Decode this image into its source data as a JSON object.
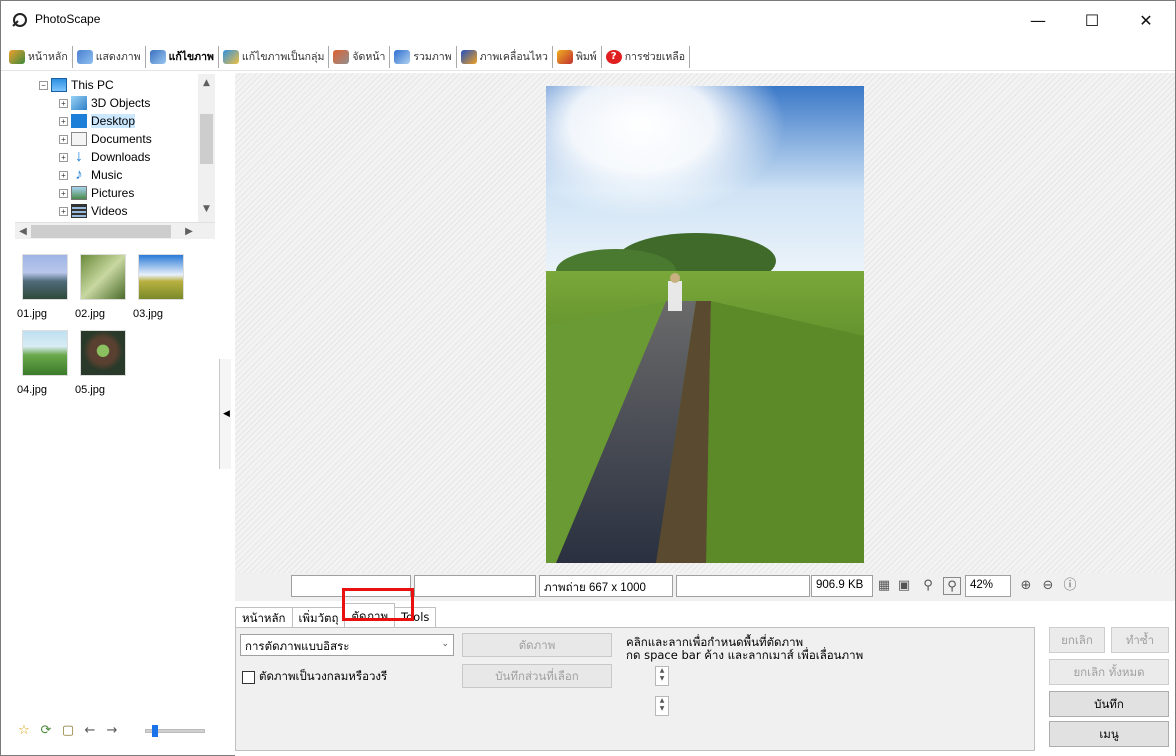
{
  "window": {
    "title": "PhotoScape"
  },
  "colors": {
    "highlight": "#e8110f",
    "selection": "#cce8ff"
  },
  "main_tabs": [
    {
      "label": "หน้าหลัก",
      "icon": "home-app-icon"
    },
    {
      "label": "แสดงภาพ",
      "icon": "viewer-icon"
    },
    {
      "label": "แก้ไขภาพ",
      "icon": "editor-icon",
      "active": true
    },
    {
      "label": "แก้ไขภาพเป็นกลุ่ม",
      "icon": "batch-icon"
    },
    {
      "label": "จัดหน้า",
      "icon": "page-icon"
    },
    {
      "label": "รวมภาพ",
      "icon": "combine-icon"
    },
    {
      "label": "ภาพเคลื่อนไหว",
      "icon": "animated-gif-icon"
    },
    {
      "label": "พิมพ์",
      "icon": "print-icon"
    },
    {
      "label": "การช่วยเหลือ",
      "icon": "help-icon"
    }
  ],
  "tree": [
    {
      "label": "This PC",
      "icon": "computer-icon"
    },
    {
      "label": "3D Objects",
      "icon": "3d-objects-icon"
    },
    {
      "label": "Desktop",
      "icon": "desktop-icon",
      "selected": true
    },
    {
      "label": "Documents",
      "icon": "documents-icon"
    },
    {
      "label": "Downloads",
      "icon": "downloads-icon"
    },
    {
      "label": "Music",
      "icon": "music-icon"
    },
    {
      "label": "Pictures",
      "icon": "pictures-icon"
    },
    {
      "label": "Videos",
      "icon": "videos-icon"
    }
  ],
  "thumbnails": [
    "01.jpg",
    "02.jpg",
    "03.jpg",
    "04.jpg",
    "05.jpg"
  ],
  "status": {
    "photo_size": "ภาพถ่าย 667 x 1000",
    "file_size": "906.9 KB",
    "zoom": "42%"
  },
  "sub_tabs": [
    "หน้าหลัก",
    "เพิ่มวัตถุ",
    "ตัดภาพ",
    "Tools"
  ],
  "crop": {
    "mode": "การตัดภาพแบบอิสระ",
    "crop_button": "ตัดภาพ",
    "save_selection_button": "บันทึกส่วนที่เลือก",
    "circle_checkbox": "ตัดภาพเป็นวงกลมหรือวงรี",
    "hint_line1": "คลิกและลากเพื่อกำหนดพื้นที่ตัดภาพ",
    "hint_line2": "กด space bar ค้าง และลากเมาส์ เพื่อเลื่อนภาพ"
  },
  "actions": {
    "undo": "ยกเลิก",
    "redo": "ทำซ้ำ",
    "undo_all": "ยกเลิก ทั้งหมด",
    "save": "บันทึก",
    "menu": "เมนู"
  }
}
